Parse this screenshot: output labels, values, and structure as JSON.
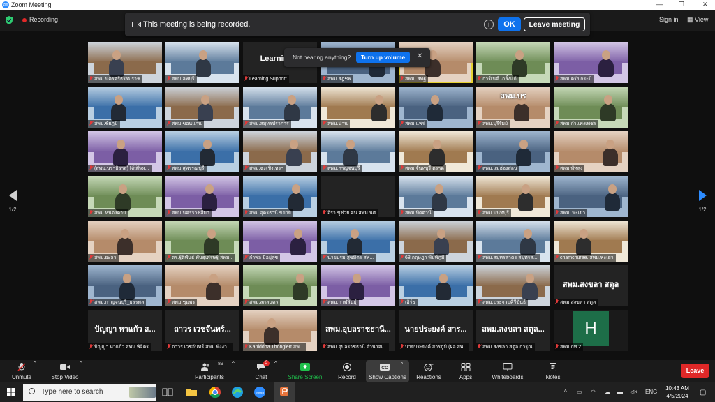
{
  "window": {
    "title": "Zoom Meeting"
  },
  "topbar": {
    "recording_label": "Recording",
    "sign_in": "Sign in",
    "view": "View"
  },
  "banner": {
    "message": "This meeting is being recorded.",
    "ok": "OK",
    "leave": "Leave meeting"
  },
  "toast": {
    "text": "Not hearing anything?",
    "button": "Turn up volume"
  },
  "pager": {
    "left": "1/2",
    "right": "1/2"
  },
  "tiles": [
    {
      "name": "สพม.นครศรีธรรมราช",
      "video": true
    },
    {
      "name": "สพม.ลพบุรี",
      "video": true
    },
    {
      "name": "Learning Support",
      "video": false,
      "big": "Learning S"
    },
    {
      "name": "สพม.สฎชพ",
      "video": true
    },
    {
      "name": "สพม. สพฐ",
      "video": true,
      "highlight": true
    },
    {
      "name": "การ์เนต์ เกลิ้งแก้",
      "video": true
    },
    {
      "name": "สพม.ตรัง กระบี่",
      "video": true
    },
    {
      "name": "สพม.ชัยภูมิ",
      "video": true
    },
    {
      "name": "สพม.ขอนแก่น",
      "video": true
    },
    {
      "name": "สพม.สมุทรปราการ",
      "video": true
    },
    {
      "name": "สพม.น่าน",
      "video": true
    },
    {
      "name": "สพม.แพร่",
      "video": true
    },
    {
      "name": "สพม.บุรีรัมย์",
      "video": true,
      "big": "สพม.บร"
    },
    {
      "name": "สพม.กำแพงเพชร",
      "video": true
    },
    {
      "name": "(สพม.นราธิวาส) Nitithor...",
      "video": true
    },
    {
      "name": "สพม.สุพรรณบุรี",
      "video": true
    },
    {
      "name": "สพม.ฉะเชิงเทรา",
      "video": true
    },
    {
      "name": "สพม.กาญจนบุรี",
      "video": true
    },
    {
      "name": "สพม.จันทบุรี ตราด",
      "video": true
    },
    {
      "name": "สพม.แม่ฮ่องสอน",
      "video": true
    },
    {
      "name": "สพม.พัทลุง",
      "video": true
    },
    {
      "name": "สพม.หนองคาย",
      "video": true
    },
    {
      "name": "สพม.นครราชสีมา",
      "video": true
    },
    {
      "name": "สพม.อุดรธานี ขยาย",
      "video": true
    },
    {
      "name": "จิรา ชูช่วย ศน.สพม.นศ",
      "video": false
    },
    {
      "name": "สพม.ปัตตานี",
      "video": true
    },
    {
      "name": "สพม.นนทบุรี",
      "video": true
    },
    {
      "name": "สพม. พะเยา",
      "video": true
    },
    {
      "name": "สพม.ยะลา",
      "video": true
    },
    {
      "name": "ดร.ฐิติพันธ์ พันธุเศรษฐ์ สพม...",
      "video": true
    },
    {
      "name": "กำพล มีอยู่สุข",
      "video": true
    },
    {
      "name": "นายบรม สุขมิตร สพ...",
      "video": true
    },
    {
      "name": "68.กฤษฎา พิมพ์ภูมิ",
      "video": true
    },
    {
      "name": "สพม.สมุทรสาคร สมุทรส...",
      "video": true
    },
    {
      "name": "chamchuree. สพม.พะเยา",
      "video": true
    },
    {
      "name": "สพม.กาญจนบุรี_ธรรพล",
      "video": true
    },
    {
      "name": "สพม.ชุมพร",
      "video": true
    },
    {
      "name": "สพม.สกลนคร",
      "video": true
    },
    {
      "name": "สพม.กาฬสินธุ์",
      "video": true
    },
    {
      "name": "เอิร์ธ",
      "video": true
    },
    {
      "name": "สพม.ประจวบคีรีขันธ์",
      "video": true
    },
    {
      "name": "สพม.สงขลา สตูล",
      "video": false,
      "big": "สพม.สงขลา สตูล"
    },
    {
      "name": "ปัญญา หาแก้ว สพม.พิจิตร",
      "video": false,
      "big": "ปัญญา หาแก้ว ส..."
    },
    {
      "name": "ถาวร เวชจันทร์ สพม พังงา...",
      "video": false,
      "big": "ถาวร เวชจันทร์..."
    },
    {
      "name": "Kaniddha Thonglert สพ...",
      "video": true
    },
    {
      "name": "สพม.อุบลราชธานี อำนาจเ...",
      "video": false,
      "big": "สพม.อุบลราชธานี..."
    },
    {
      "name": "นายประยงค์ สารภูมิ (ผอ.สพ...",
      "video": false,
      "big": "นายประยงค์ สาร..."
    },
    {
      "name": "สพม.สงขลา สตูล การุณ",
      "video": false,
      "big": "สพม.สงขลา สตูล..."
    },
    {
      "name": "สพม กท 2",
      "video": false,
      "initial": "H"
    }
  ],
  "toolbar": {
    "unmute": "Unmute",
    "stop_video": "Stop Video",
    "participants": "Participants",
    "participants_count": "89",
    "chat": "Chat",
    "chat_badge": "3",
    "share_screen": "Share Screen",
    "record": "Record",
    "show_captions": "Show Captions",
    "reactions": "Reactions",
    "apps": "Apps",
    "whiteboards": "Whiteboards",
    "notes": "Notes",
    "leave": "Leave"
  },
  "taskbar": {
    "search_placeholder": "Type here to search",
    "lang": "ENG",
    "time": "10:43 AM",
    "date": "4/5/2024"
  },
  "colors": {
    "accent_blue": "#0e72ed",
    "leave_red": "#e02828",
    "share_green": "#1fbf4b",
    "highlight_yellow": "#e6d232"
  }
}
